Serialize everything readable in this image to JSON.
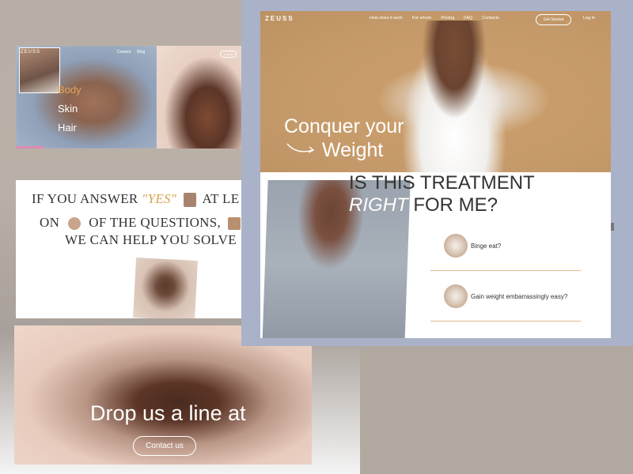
{
  "panel_a": {
    "logo": "ZEUSS",
    "nav": [
      "Contact",
      "Blog"
    ],
    "menu": [
      "Body",
      "Skin",
      "Hair"
    ],
    "login": "Log in",
    "active_color": "#e6a35a"
  },
  "panel_b": {
    "line1_a": "IF YOU ANSWER",
    "line1_yes": "\"YES\"",
    "line1_b": "AT LE",
    "line2_a": "ON",
    "line2_b": "OF THE QUESTIONS,",
    "line3": "WE CAN HELP YOU SOLVE"
  },
  "panel_d": {
    "headline": "Drop us a line at",
    "button": "Contact us"
  },
  "site": {
    "logo": "ZEUSS",
    "nav": [
      "How does it work",
      "For whom",
      "Pricing",
      "FAQ",
      "Contacts"
    ],
    "cta": "Get Started",
    "login": "Log in",
    "hero_line1": "Conquer your",
    "hero_line2": "Weight",
    "section_title_1": "IS THIS TREATMENT",
    "section_title_italic": "RIGHT",
    "section_title_2": "FOR ME?",
    "questions": [
      "Binge eat?",
      "Gain weight embarrassingly easy?"
    ],
    "accent_color": "#e4b98a"
  }
}
